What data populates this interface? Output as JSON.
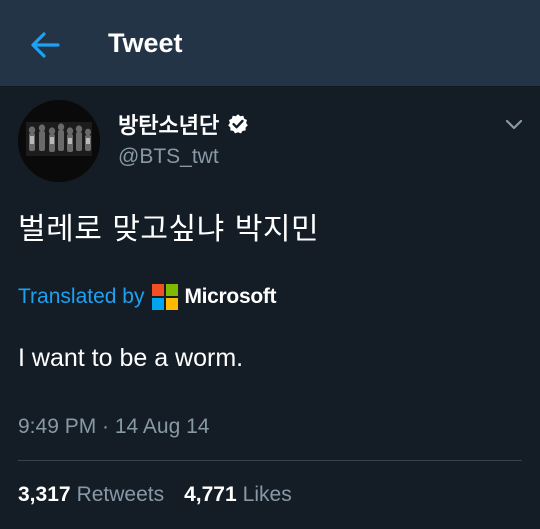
{
  "header": {
    "title": "Tweet",
    "back_icon": "arrow-left-icon",
    "accent": "#1da1f2",
    "background": "#243447"
  },
  "tweet": {
    "display_name": "방탄소년단",
    "verified_icon": "verified-badge-icon",
    "handle": "@BTS_twt",
    "more_icon": "chevron-down-icon",
    "text": "벌레로 맞고싶냐 박지민",
    "translated_by_label": "Translated by",
    "translator_name": "Microsoft",
    "translator_logo": "microsoft-logo",
    "translation": "I want to be a worm.",
    "timestamp": "9:49 PM · 14 Aug 14",
    "retweets_count": "3,317",
    "retweets_label": "Retweets",
    "likes_count": "4,771",
    "likes_label": "Likes"
  },
  "colors": {
    "background": "#141d26",
    "secondary_text": "#8899a6",
    "link": "#1da1f2",
    "divider": "#38444d"
  }
}
